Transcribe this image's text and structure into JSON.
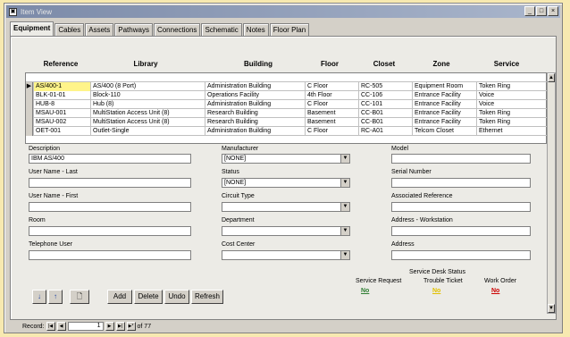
{
  "window": {
    "title": "Item View",
    "min": "_",
    "max": "□",
    "close": "×"
  },
  "tabs": [
    "Equipment",
    "Cables",
    "Assets",
    "Pathways",
    "Connections",
    "Schematic",
    "Notes",
    "Floor Plan"
  ],
  "grid": {
    "columns": [
      "Reference",
      "Library",
      "Building",
      "Floor",
      "Closet",
      "Zone",
      "Service"
    ],
    "rows": [
      [
        "AS/400-1",
        "AS/400 (8 Port)",
        "Administration Building",
        "C Floor",
        "RC-505",
        "Equipment Room",
        "Token Ring"
      ],
      [
        "BLK-01-01",
        "Block-110",
        "Operations Facility",
        "4th Floor",
        "CC-106",
        "Entrance Facility",
        "Voice"
      ],
      [
        "HUB-8",
        "Hub (8)",
        "Administration Building",
        "C Floor",
        "CC-101",
        "Entrance Facility",
        "Voice"
      ],
      [
        "MSAU-001",
        "MultiStation Access Unit (8)",
        "Research Building",
        "Basement",
        "CC-B01",
        "Entrance Facility",
        "Token Ring"
      ],
      [
        "MSAU-002",
        "MultiStation Access Unit (8)",
        "Research Building",
        "Basement",
        "CC-B01",
        "Entrance Facility",
        "Token Ring"
      ],
      [
        "OET-001",
        "Outlet-Single",
        "Administration Building",
        "C Floor",
        "RC-A01",
        "Telcom Closet",
        "Ethernet"
      ]
    ],
    "current_marker": "▶"
  },
  "form": {
    "description_label": "Description",
    "description_value": "IBM AS/400",
    "manufacturer_label": "Manufacturer",
    "manufacturer_value": "[NONE]",
    "model_label": "Model",
    "model_value": "",
    "username_last_label": "User Name - Last",
    "username_last_value": "",
    "status_label": "Status",
    "status_value": "[NONE]",
    "serial_label": "Serial Number",
    "serial_value": "",
    "username_first_label": "User Name - First",
    "username_first_value": "",
    "circuit_label": "Circuit Type",
    "circuit_value": "",
    "assoc_label": "Associated Reference",
    "assoc_value": "",
    "room_label": "Room",
    "room_value": "",
    "department_label": "Department",
    "department_value": "",
    "addr_ws_label": "Address - Workstation",
    "addr_ws_value": "",
    "phone_label": "Telephone User",
    "phone_value": "",
    "cost_label": "Cost Center",
    "cost_value": "",
    "address_label": "Address",
    "address_value": ""
  },
  "service_desk": {
    "title": "Service Desk Status",
    "request_label": "Service Request",
    "request_value": "No",
    "trouble_label": "Trouble Ticket",
    "trouble_value": "No",
    "work_label": "Work Order",
    "work_value": "No",
    "colors": {
      "green": "#2e7d32",
      "yellow": "#e0c000",
      "red": "#cc0000"
    }
  },
  "buttons": {
    "down_arrow": "↓",
    "up_arrow": "↑",
    "add": "Add",
    "delete": "Delete",
    "undo": "Undo",
    "refresh": "Refresh"
  },
  "nav": {
    "label": "Record:",
    "first": "|◀",
    "prev": "◀",
    "current": "1",
    "next": "▶",
    "last": "▶|",
    "new": "▶*",
    "of_text": "of 77"
  }
}
